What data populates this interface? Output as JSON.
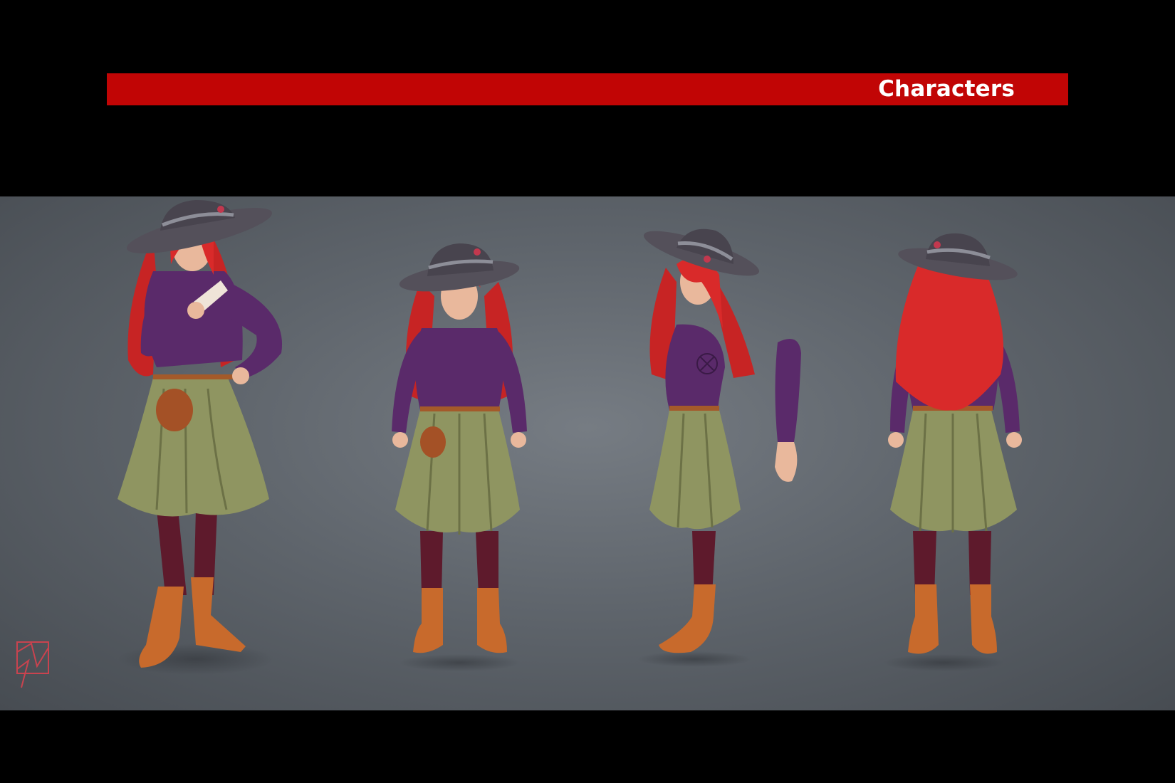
{
  "slide": {
    "section_title": "Characters",
    "banner_color": "#c10505",
    "background_color": "#000000"
  },
  "artwork": {
    "description_icons": [
      "character-front-pose",
      "character-front-view",
      "character-side-view",
      "character-back-view",
      "artist-monogram-icon"
    ],
    "palette": {
      "hair": "#d92a2a",
      "hat": "#54505a",
      "sweater": "#5a2a6a",
      "skirt": "#8f9561",
      "tights": "#5e1a2c",
      "boots": "#c86a2c",
      "skin": "#e9b89c",
      "canvas": "#676d74"
    }
  }
}
